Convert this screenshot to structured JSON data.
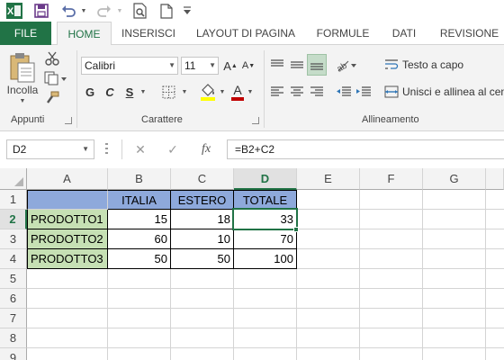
{
  "qat": {
    "icons": [
      "excel-logo-icon",
      "save-icon",
      "undo-icon",
      "undo-dropdown-icon",
      "redo-icon",
      "redo-dropdown-icon",
      "print-preview-icon",
      "new-file-icon",
      "customize-qat-icon"
    ]
  },
  "tabs": [
    {
      "label": "FILE"
    },
    {
      "label": "HOME"
    },
    {
      "label": "INSERISCI"
    },
    {
      "label": "LAYOUT DI PAGINA"
    },
    {
      "label": "FORMULE"
    },
    {
      "label": "DATI"
    },
    {
      "label": "REVISIONE"
    }
  ],
  "ribbon": {
    "paste_label": "Incolla",
    "font_name": "Calibri",
    "font_size": "11",
    "bold": "G",
    "italic": "C",
    "underline": "S",
    "wrap_text": "Testo a capo",
    "merge_center": "Unisci e allinea al centro",
    "groups": {
      "clipboard": "Appunti",
      "font": "Carattere",
      "alignment": "Allineamento"
    },
    "font_color": "#c00000",
    "fill_color": "#ffff00"
  },
  "formula_bar": {
    "name_box": "D2",
    "fx": "fx",
    "formula": "=B2+C2"
  },
  "sheet": {
    "columns": [
      "A",
      "B",
      "C",
      "D",
      "E",
      "F",
      "G"
    ],
    "rows": [
      "1",
      "2",
      "3",
      "4",
      "5",
      "6",
      "7",
      "8",
      "9"
    ],
    "selected_col": "D",
    "selected_row": "2",
    "header": [
      "",
      "ITALIA",
      "ESTERO",
      "TOTALE"
    ],
    "data": [
      [
        "PRODOTTO1",
        "15",
        "18",
        "33"
      ],
      [
        "PRODOTTO2",
        "60",
        "10",
        "70"
      ],
      [
        "PRODOTTO3",
        "50",
        "50",
        "100"
      ]
    ],
    "colors": {
      "header_fill": "#8ea9db",
      "product_fill": "#c6e0b4",
      "accent": "#217346"
    }
  }
}
